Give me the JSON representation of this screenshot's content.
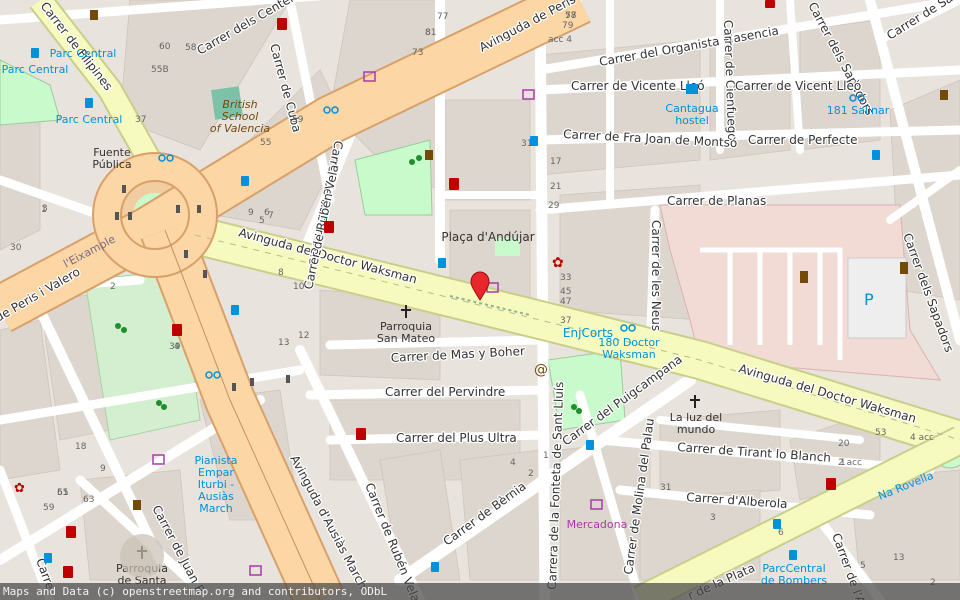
{
  "colors": {
    "background": "#e8e3dc",
    "building": "#d9d0c9",
    "block": "#ddd6ce",
    "road_minor": "#ffffff",
    "road_major_fill": "#f7fabf",
    "road_major_casing": "#c9cf8a",
    "road_primary_fill": "#fcd6a4",
    "road_primary_casing": "#d9a06a",
    "park": "#c8facc",
    "park_dark": "#add19e",
    "hospital_area": "#ffe3de",
    "hospital_icon": "#bf0000",
    "bus_icon": "#0092da",
    "shop_icon": "#ac39ac",
    "marker": "#e8262b",
    "street_text": "#333333",
    "poi_text_blue": "#0092da",
    "poi_text_brown": "#734a08",
    "green_text": "#1f8e2b"
  },
  "streets": {
    "avinguda_doctor_waksman_1": "Avinguda del Doctor Waksman",
    "avinguda_doctor_waksman_2": "Avinguda del Doctor Waksman",
    "avinguda_peris_valero_1": "Avinguda de Peris i Valero",
    "avinguda_peris_valero_2": "de Peris i Valero",
    "carrer_centelles": "Carrer dels Centelles",
    "carrer_cuba": "Carrer de Cuba",
    "carrer_ruben_vela_1": "Carrer de Rubén Vela",
    "carrer_ruben_vela_2": "Carrer de Rubén Vela",
    "carrer_ruben_vela_3": "Carrer de Rubén Vela",
    "carrer_organista_plasencia": "Carrer del Organista Plasencia",
    "carrer_cienfuegos": "Carrer de Cienfuegos",
    "carrer_sapadors_1": "Carrer dels Sapadors",
    "carrer_sapadors_2": "Carrer dels Sapadors",
    "carrer_salvador": "Carrer de Salv",
    "carrer_vicente_lleo_1": "Carrer de Vicente Lleó",
    "carrer_vicente_lleo_2": "Carrer de Vicent Lleó",
    "carrer_fra_joan_montso": "Carrer de Fra Joan de Montsó",
    "carrer_perfecte": "Carrer de Perfecte",
    "carrer_planas": "Carrer de Planas",
    "carrer_les_neus": "Carrer de les Neus",
    "carrer_mas_boher": "Carrer de Mas y Boher",
    "carrer_pervindre": "Carrer del Pervindre",
    "carrer_plus_ultra": "Carrer del Plus Ultra",
    "carrer_puigcampana": "Carrer del Puigcampana",
    "carrer_fonteta_sant_lluis": "Carrera de la Fonteta de Sant Lluís",
    "carrer_bernia": "Carrer de Bèrnia",
    "carrer_molina_palau": "Carrer de Molina del Palau",
    "carrer_tirant_blanch": "Carrer de Tirant lo Blanch",
    "carrer_alberola": "Carrer d'Alberola",
    "avinguda_ausias_march": "Avinguda d'Ausiàs March",
    "carrer_juan_r": "Carrer de Juan R",
    "carrer_filipines": "Carrer de Filipines",
    "carrer_la_plata": "r de la Plata",
    "carrer_astur": "Carrer de l'Astur",
    "na_rovella": "Na Rovella",
    "carre_left": "Carre",
    "leixample": "l'Eixample"
  },
  "pois": {
    "parc_central_1": "Parc Central",
    "parc_central_2": "Parc Central",
    "parc_central_3": "Parc Central",
    "british_school_1": "British",
    "british_school_2": "School",
    "british_school_3": "of Valencia",
    "fuente_1": "Fuente",
    "fuente_2": "Pública",
    "placa_andujar": "Plaça d'Andújar",
    "cantagua_1": "Cantagua",
    "cantagua_2": "hostel",
    "salinar": "181 Salinar",
    "parroquia_san_mateo_1": "Parroquia",
    "parroquia_san_mateo_2": "San Mateo",
    "enicorts": "EnjCorts",
    "doctor_waksman_stop_1": "180 Doctor",
    "doctor_waksman_stop_2": "Waksman",
    "la_luz_1": "La luz del",
    "la_luz_2": "mundo",
    "pianista_1": "Pianista",
    "pianista_2": "Empar",
    "pianista_3": "Iturbi -",
    "pianista_4": "Ausiàs",
    "pianista_5": "March",
    "mercadona": "Mercadona",
    "parc_bombers_1": "ParcCentral",
    "parc_bombers_2": "de Bombers",
    "parroquia_santa_1": "Parroquia",
    "parroquia_santa_2": "de Santa"
  },
  "house_numbers": [
    "78",
    "81",
    "79",
    "acc 4",
    "60",
    "58",
    "55B",
    "37",
    "55",
    "59",
    "73",
    "77",
    "6",
    "5",
    "7",
    "9",
    "10",
    "8",
    "13",
    "12",
    "1",
    "3",
    "30",
    "31",
    "17",
    "21",
    "29",
    "33",
    "45",
    "47",
    "37",
    "39",
    "4",
    "2",
    "18",
    "9",
    "55",
    "61",
    "59",
    "63",
    "4",
    "1",
    "2",
    "20",
    "1",
    "2 acc",
    "4 acc",
    "6",
    "31",
    "3",
    "5",
    "13",
    "2",
    "53",
    "57",
    "8"
  ],
  "map_marker_label": "location-marker",
  "attribution": "Maps and Data (c) openstreetmap.org and contributors, ODbL"
}
